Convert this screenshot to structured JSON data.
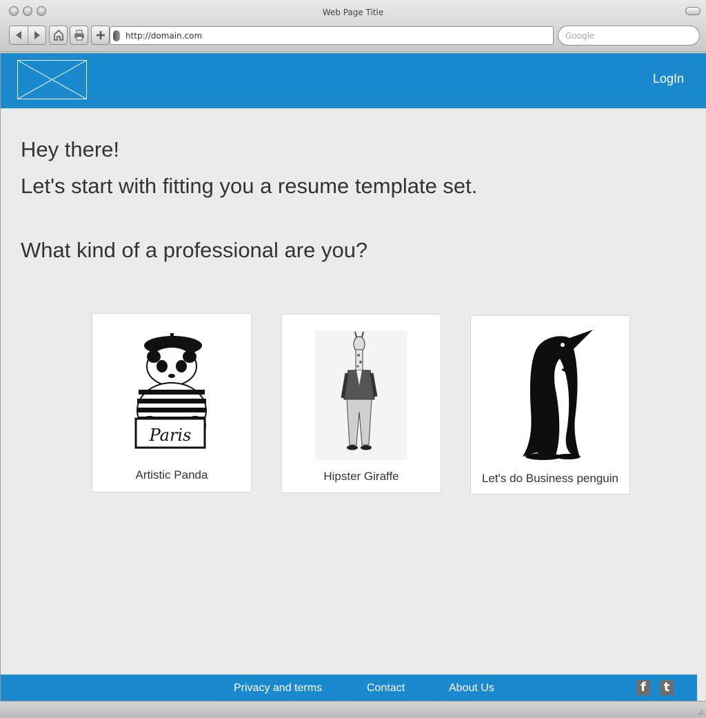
{
  "browser": {
    "window_title": "Web Page Title",
    "url": "http://domain.com",
    "search_placeholder": "Google"
  },
  "header": {
    "login_label": "LogIn"
  },
  "hero": {
    "greeting": "Hey there!",
    "intro": "Let's start with fitting you a resume template set.",
    "question": "What kind of a professional are you?"
  },
  "options": [
    {
      "label": "Artistic Panda",
      "image": "panda-beret-paris"
    },
    {
      "label": "Hipster Giraffe",
      "image": "giraffe-in-suit"
    },
    {
      "label": "Let's do Business penguin",
      "image": "penguin-bowtie"
    }
  ],
  "footer": {
    "links": [
      "Privacy and terms",
      "Contact",
      "About Us"
    ],
    "social": [
      {
        "icon": "facebook-icon",
        "glyph": "f"
      },
      {
        "icon": "twitter-icon",
        "glyph": "t"
      }
    ]
  },
  "colors": {
    "brand_blue": "#1a89ce",
    "page_bg": "#ebebeb"
  }
}
